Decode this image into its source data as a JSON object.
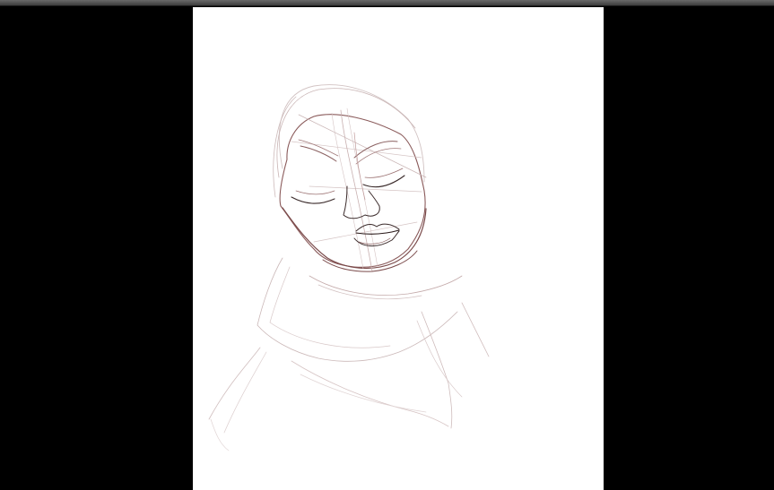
{
  "app": {
    "window_title": ""
  },
  "canvas": {
    "background_color": "#ffffff",
    "sketch_color_primary": "#8a5a5a",
    "sketch_color_dark": "#3a2a2a",
    "sketch_color_light": "#c9b4b4",
    "content": "sketch-of-hooded-figure"
  },
  "workspace": {
    "background_color": "#000000"
  }
}
